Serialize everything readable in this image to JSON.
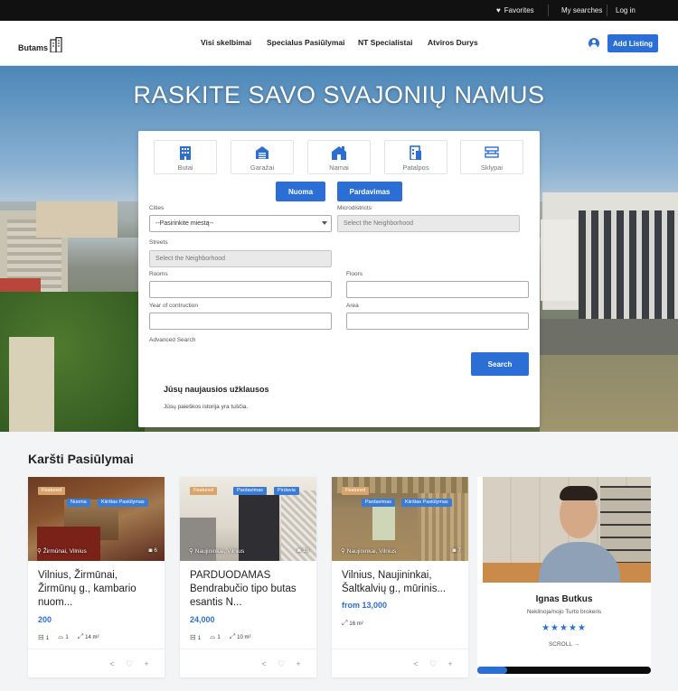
{
  "topbar": {
    "favorites": "Favorites",
    "my_searches": "My searches",
    "login": "Log in"
  },
  "header": {
    "logo": "Butams",
    "nav": [
      "Visi skelbimai",
      "Specialus Pasiūlymai",
      "NT Specialistai",
      "Atviros Durys"
    ],
    "add_listing": "Add Listing"
  },
  "hero": {
    "title": "RASKITE SAVO SVAJONIŲ NAMUS"
  },
  "search": {
    "property_types": [
      {
        "label": "Butai",
        "icon": "building-icon"
      },
      {
        "label": "Garažai",
        "icon": "garage-icon"
      },
      {
        "label": "Namai",
        "icon": "house-icon"
      },
      {
        "label": "Patalpos",
        "icon": "office-icon"
      },
      {
        "label": "Sklypai",
        "icon": "land-plot-icon"
      }
    ],
    "deal_types": [
      "Nuoma",
      "Pardavimas"
    ],
    "cities_label": "Cities",
    "cities_value": "--Pasirinkite miestą--",
    "microdistricts_label": "Microdistricts",
    "microdistricts_value": "Select the Neighborhood",
    "streets_label": "Streets",
    "streets_value": "Select the Neighborhood",
    "rooms_label": "Rooms",
    "floors_label": "Floors",
    "year_label": "Year of contruction",
    "area_label": "Area",
    "advanced": "Advanced Search",
    "search_button": "Search",
    "recent_title": "Jūsų naujausios užklausos",
    "recent_empty": "Jūsų paieškos istorija yra tuščia."
  },
  "offers": {
    "title": "Karšti Pasiūlymai",
    "cards": [
      {
        "badges": [
          "Featured",
          "Nuoma",
          "Kiirštas Pasiūlymas"
        ],
        "location": "Žirmūnai, Vilnius",
        "photos": "6",
        "title": "Vilnius, Žirmūnai, Žirmūnų g., kambario nuom...",
        "price": "200",
        "beds": "1",
        "baths": "1",
        "area": "14 m²"
      },
      {
        "badges": [
          "Featured",
          "Pardavimas",
          "Pirdavia"
        ],
        "location": "Naujininkai, Vilnius",
        "photos": "13",
        "title": "PARDUODAMAS Bendrabučio tipo butas esantis N...",
        "price": "24,000",
        "beds": "1",
        "baths": "1",
        "area": "10 m²"
      },
      {
        "badges": [
          "Featured",
          "Pardavimas",
          "Kiirštas Pasiūlymas"
        ],
        "location": "Naujininkai, Vilnius",
        "photos": "7",
        "title": "Vilnius, Naujininkai, Šaltkalvių g., mūrinis...",
        "price": "from 13,000",
        "area": "16 m²"
      }
    ]
  },
  "agent": {
    "name": "Ignas Butkus",
    "role": "Nekilnojamojo Turto brokeris",
    "stars": "★★★★★",
    "rating": 5,
    "scroll": "SCROLL →"
  },
  "colors": {
    "accent": "#2b6fd6",
    "featured_badge": "#d9a46b",
    "topbar": "#111111"
  }
}
